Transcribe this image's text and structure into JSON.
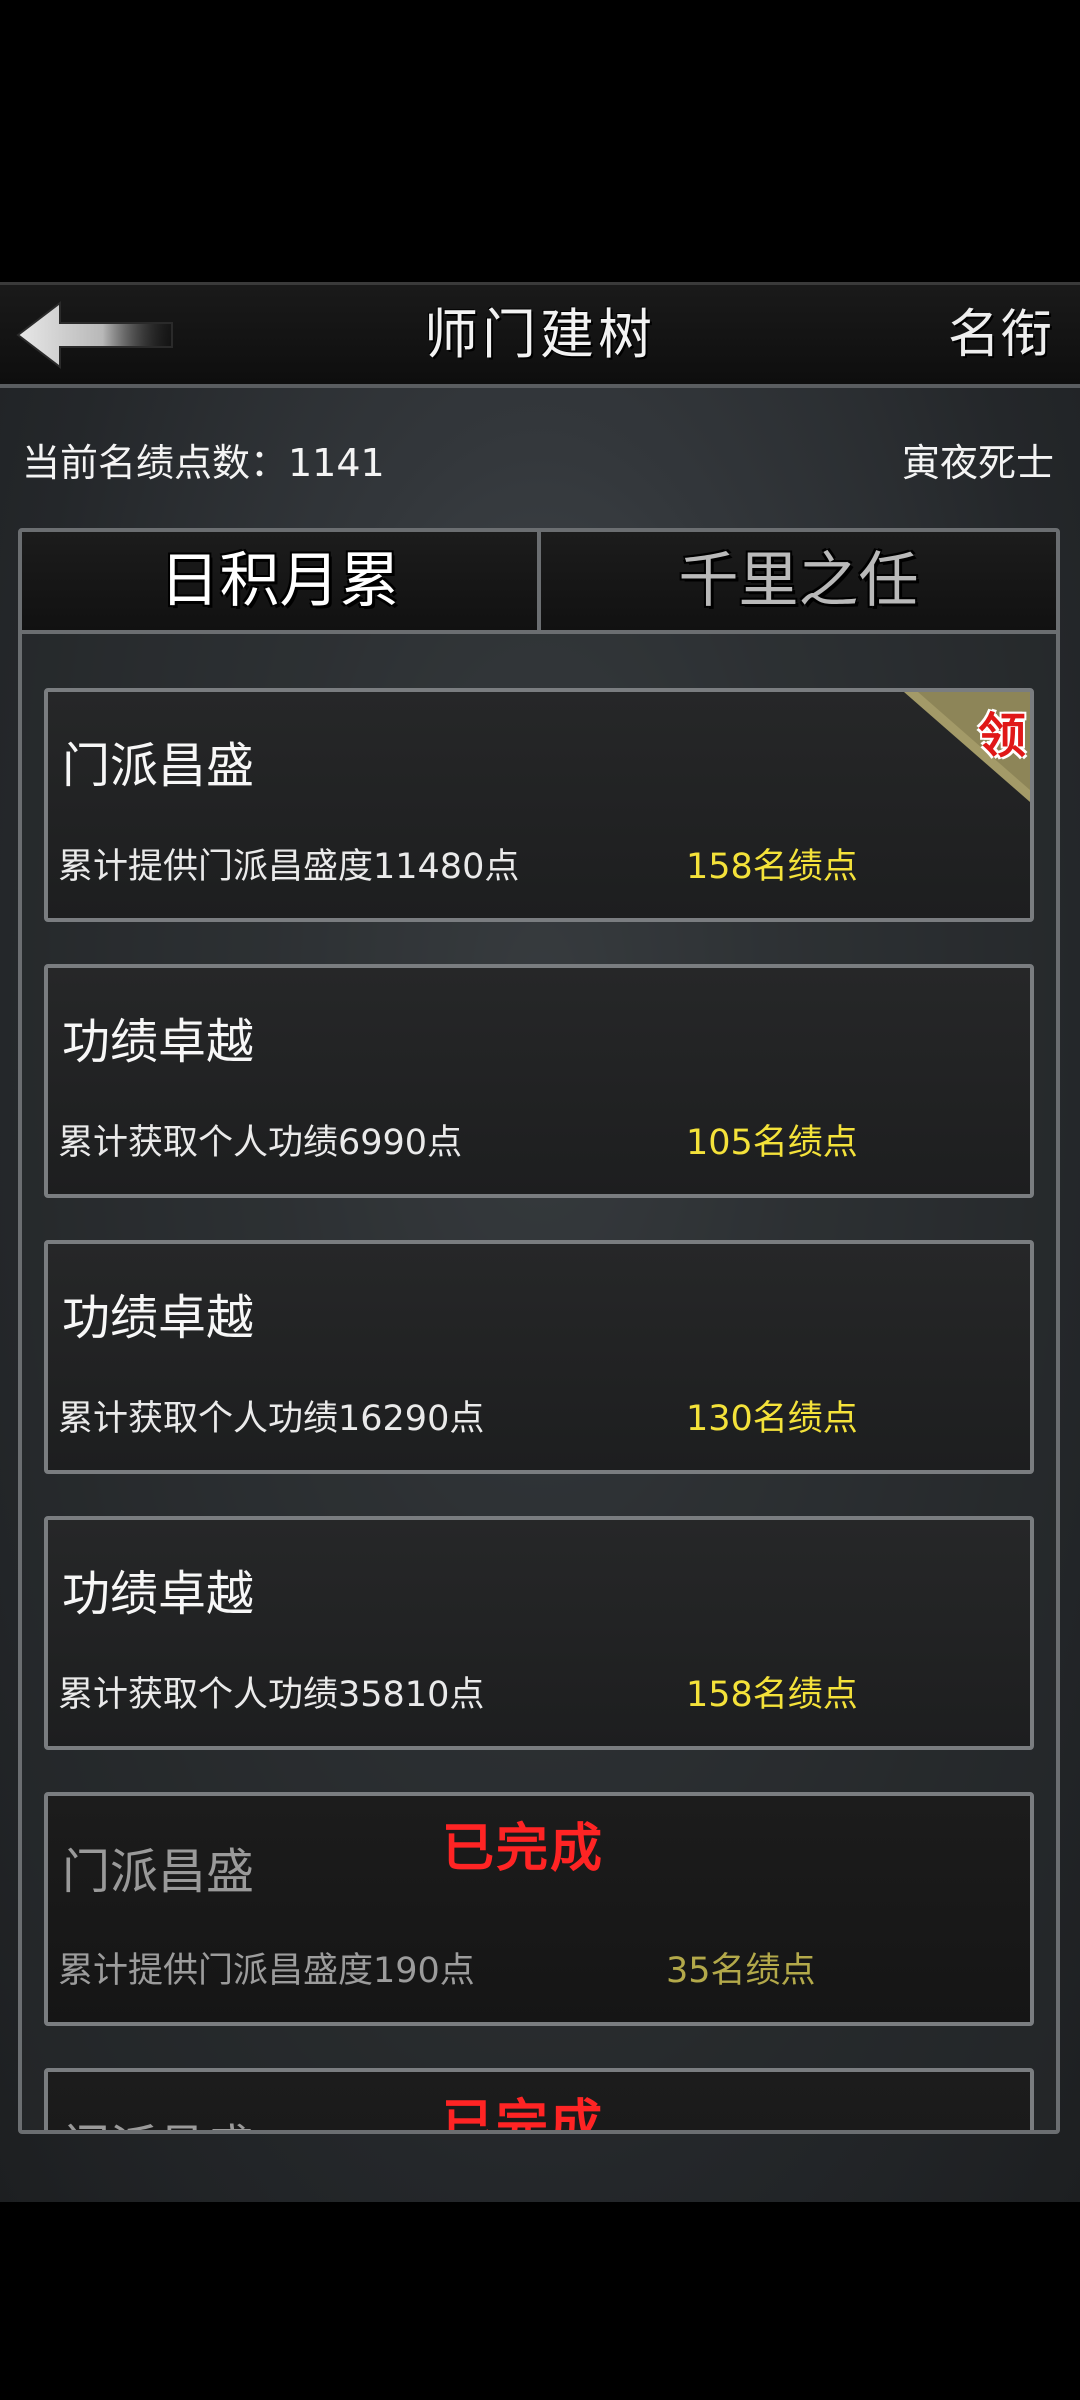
{
  "header": {
    "title": "师门建树",
    "right_label": "名衔"
  },
  "info": {
    "points_label": "当前名绩点数：1141",
    "player_title": "寅夜死士"
  },
  "tabs": [
    {
      "label": "日积月累",
      "active": true
    },
    {
      "label": "千里之任",
      "active": false
    }
  ],
  "tasks": [
    {
      "title": "门派昌盛",
      "desc": "累计提供门派昌盛度11480点",
      "reward": "158名绩点",
      "status": "claimable",
      "claim_label": "领"
    },
    {
      "title": "功绩卓越",
      "desc": "累计获取个人功绩6990点",
      "reward": "105名绩点",
      "status": "in_progress"
    },
    {
      "title": "功绩卓越",
      "desc": "累计获取个人功绩16290点",
      "reward": "130名绩点",
      "status": "in_progress"
    },
    {
      "title": "功绩卓越",
      "desc": "累计获取个人功绩35810点",
      "reward": "158名绩点",
      "status": "in_progress"
    },
    {
      "title": "门派昌盛",
      "desc": "累计提供门派昌盛度190点",
      "reward": "35名绩点",
      "status": "completed",
      "status_label": "已完成"
    },
    {
      "title": "门派昌盛",
      "desc": "",
      "reward": "",
      "status": "completed",
      "status_label": "已完成"
    }
  ],
  "colors": {
    "reward": "#f4e23a",
    "completed": "#ff2424",
    "claim": "#e01818"
  },
  "icons": {
    "back": "back-arrow-icon"
  }
}
